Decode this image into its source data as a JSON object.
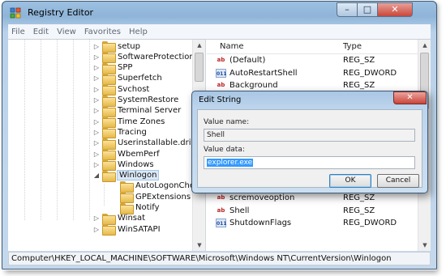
{
  "window": {
    "title": "Registry Editor",
    "minimize_glyph": "–",
    "maximize_glyph": "□",
    "close_glyph": "✕"
  },
  "menu": [
    "File",
    "Edit",
    "View",
    "Favorites",
    "Help"
  ],
  "tree": {
    "items": [
      {
        "label": "setup",
        "expanded": false,
        "selected": false
      },
      {
        "label": "SoftwareProtectionPlatform",
        "expanded": false,
        "selected": false
      },
      {
        "label": "SPP",
        "expanded": false,
        "selected": false
      },
      {
        "label": "Superfetch",
        "expanded": false,
        "selected": false
      },
      {
        "label": "Svchost",
        "expanded": false,
        "selected": false
      },
      {
        "label": "SystemRestore",
        "expanded": false,
        "selected": false
      },
      {
        "label": "Terminal Server",
        "expanded": false,
        "selected": false
      },
      {
        "label": "Time Zones",
        "expanded": false,
        "selected": false
      },
      {
        "label": "Tracing",
        "expanded": false,
        "selected": false
      },
      {
        "label": "Userinstallable.drivers",
        "expanded": false,
        "selected": false
      },
      {
        "label": "WbemPerf",
        "expanded": false,
        "selected": false
      },
      {
        "label": "Windows",
        "expanded": false,
        "selected": false
      },
      {
        "label": "Winlogon",
        "expanded": true,
        "selected": true
      },
      {
        "label": "AutoLogonChecked",
        "expanded": false,
        "selected": false,
        "child": true
      },
      {
        "label": "GPExtensions",
        "expanded": false,
        "selected": false,
        "child": true
      },
      {
        "label": "Notify",
        "expanded": false,
        "selected": false,
        "child": true
      },
      {
        "label": "Winsat",
        "expanded": false,
        "selected": false
      },
      {
        "label": "WinSATAPI",
        "expanded": false,
        "selected": false
      }
    ]
  },
  "values": {
    "header_name": "Name",
    "header_type": "Type",
    "rows_top": [
      {
        "name": "(Default)",
        "type": "REG_SZ",
        "icon": "string-value-icon"
      },
      {
        "name": "AutoRestartShell",
        "type": "REG_DWORD",
        "icon": "binary-value-icon"
      },
      {
        "name": "Background",
        "type": "REG_SZ",
        "icon": "string-value-icon"
      }
    ],
    "rows_bottom": [
      {
        "name": "scremoveoption",
        "type": "REG_SZ",
        "icon": "string-value-icon"
      },
      {
        "name": "Shell",
        "type": "REG_SZ",
        "icon": "string-value-icon"
      },
      {
        "name": "ShutdownFlags",
        "type": "REG_DWORD",
        "icon": "binary-value-icon"
      }
    ]
  },
  "status_path": "Computer\\HKEY_LOCAL_MACHINE\\SOFTWARE\\Microsoft\\Windows NT\\CurrentVersion\\Winlogon",
  "dialog": {
    "title": "Edit String",
    "close_glyph": "✕",
    "value_name_label": "Value name:",
    "value_name": "Shell",
    "value_data_label": "Value data:",
    "value_data": "explorer.exe",
    "ok_label": "OK",
    "cancel_label": "Cancel"
  },
  "colors": {
    "selection": "#3399ff",
    "close_button": "#c9463a",
    "window_frame": "#9cc0e0"
  }
}
